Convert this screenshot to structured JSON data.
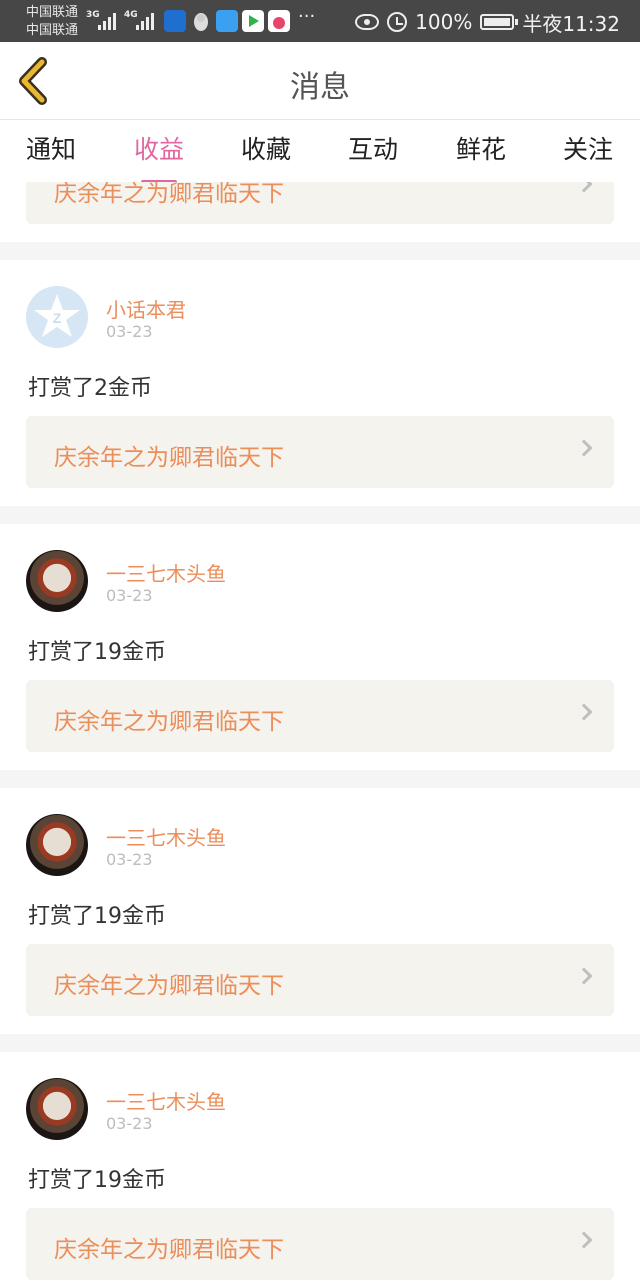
{
  "status_bar": {
    "carrier_1": "中国联通",
    "carrier_2": "中国联通",
    "net_1": "3G",
    "net_2": "4G",
    "more": "···",
    "battery": "100%",
    "time": "半夜11:32"
  },
  "nav": {
    "title": "消息"
  },
  "tabs": [
    {
      "label": "通知",
      "active": false
    },
    {
      "label": "收益",
      "active": true
    },
    {
      "label": "收藏",
      "active": false
    },
    {
      "label": "互动",
      "active": false
    },
    {
      "label": "鲜花",
      "active": false
    },
    {
      "label": "关注",
      "active": false
    }
  ],
  "partial_card": {
    "book_title": "庆余年之为卿君临天下"
  },
  "messages": [
    {
      "user": "小话本君",
      "date": "03-23",
      "action": "打赏了2金币",
      "book_title": "庆余年之为卿君临天下",
      "avatar": "qq-avatar"
    },
    {
      "user": "一三七木头鱼",
      "date": "03-23",
      "action": "打赏了19金币",
      "book_title": "庆余年之为卿君临天下",
      "avatar": "food-avatar"
    },
    {
      "user": "一三七木头鱼",
      "date": "03-23",
      "action": "打赏了19金币",
      "book_title": "庆余年之为卿君临天下",
      "avatar": "food-avatar"
    },
    {
      "user": "一三七木头鱼",
      "date": "03-23",
      "action": "打赏了19金币",
      "book_title": "庆余年之为卿君临天下",
      "avatar": "food-avatar"
    }
  ],
  "colors": {
    "accent": "#e0679f",
    "book_text": "#ec8d5a",
    "back_icon": "#e9b732"
  }
}
